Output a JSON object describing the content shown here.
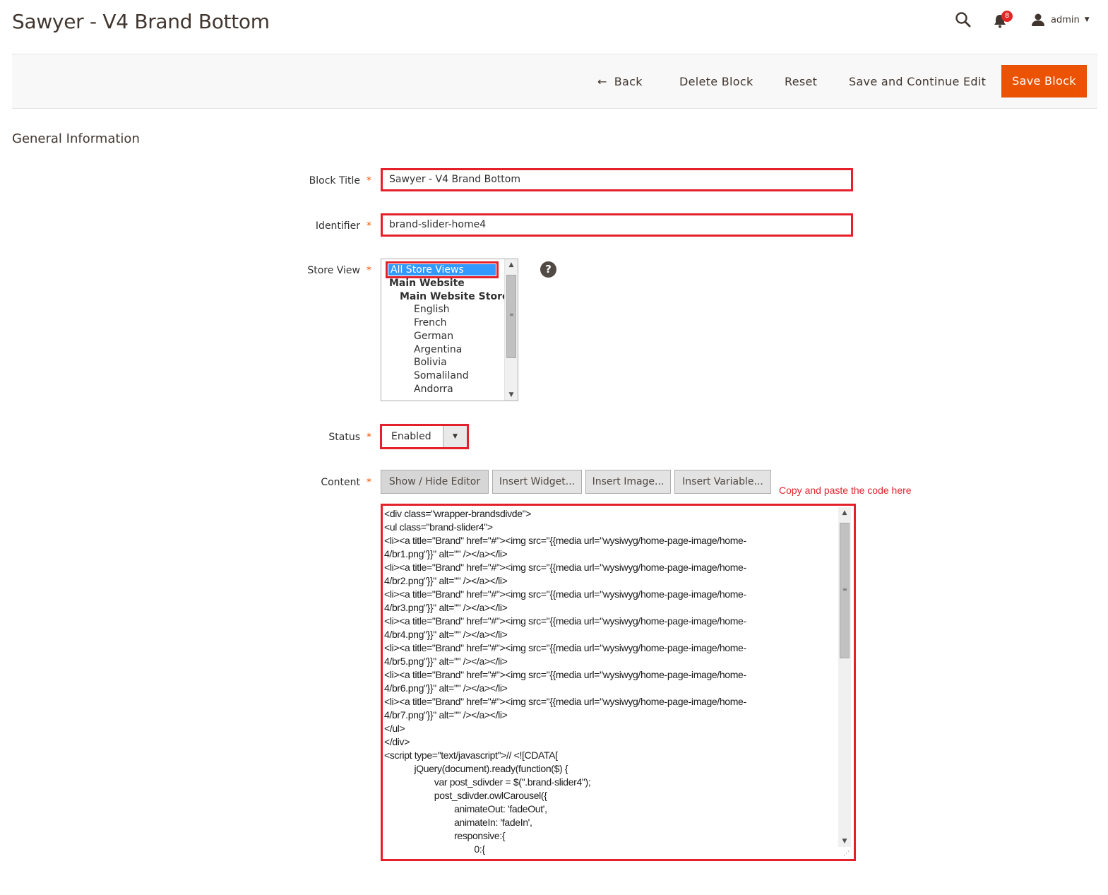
{
  "header": {
    "title": "Sawyer - V4 Brand Bottom",
    "notification_count": "8",
    "user_name": "admin"
  },
  "actions": {
    "back_label": "Back",
    "delete_label": "Delete Block",
    "reset_label": "Reset",
    "save_continue_label": "Save and Continue Edit",
    "save_label": "Save Block"
  },
  "section": {
    "title": "General Information"
  },
  "form": {
    "block_title": {
      "label": "Block Title",
      "value": "Sawyer - V4 Brand Bottom"
    },
    "identifier": {
      "label": "Identifier",
      "value": "brand-slider-home4"
    },
    "store_view": {
      "label": "Store View",
      "selected": "All Store Views",
      "options": [
        {
          "text": "Main Website",
          "level": 0,
          "bold": true
        },
        {
          "text": "Main Website Store",
          "level": 1,
          "bold": true
        },
        {
          "text": "English",
          "level": 2,
          "bold": false
        },
        {
          "text": "French",
          "level": 2,
          "bold": false
        },
        {
          "text": "German",
          "level": 2,
          "bold": false
        },
        {
          "text": "Argentina",
          "level": 2,
          "bold": false
        },
        {
          "text": "Bolivia",
          "level": 2,
          "bold": false
        },
        {
          "text": "Somaliland",
          "level": 2,
          "bold": false
        },
        {
          "text": "Andorra",
          "level": 2,
          "bold": false
        }
      ]
    },
    "status": {
      "label": "Status",
      "value": "Enabled"
    },
    "content": {
      "label": "Content",
      "buttons": [
        "Show / Hide Editor",
        "Insert Widget...",
        "Insert Image...",
        "Insert Variable..."
      ],
      "annotation": "Copy and paste the code here",
      "code": "<div class=\"wrapper-brandsdivde\">\n<ul class=\"brand-slider4\">\n<li><a title=\"Brand\" href=\"#\"><img src=\"{{media url=\"wysiwyg/home-page-image/home-\n4/br1.png\"}}\" alt=\"\" /></a></li>\n<li><a title=\"Brand\" href=\"#\"><img src=\"{{media url=\"wysiwyg/home-page-image/home-\n4/br2.png\"}}\" alt=\"\" /></a></li>\n<li><a title=\"Brand\" href=\"#\"><img src=\"{{media url=\"wysiwyg/home-page-image/home-\n4/br3.png\"}}\" alt=\"\" /></a></li>\n<li><a title=\"Brand\" href=\"#\"><img src=\"{{media url=\"wysiwyg/home-page-image/home-\n4/br4.png\"}}\" alt=\"\" /></a></li>\n<li><a title=\"Brand\" href=\"#\"><img src=\"{{media url=\"wysiwyg/home-page-image/home-\n4/br5.png\"}}\" alt=\"\" /></a></li>\n<li><a title=\"Brand\" href=\"#\"><img src=\"{{media url=\"wysiwyg/home-page-image/home-\n4/br6.png\"}}\" alt=\"\" /></a></li>\n<li><a title=\"Brand\" href=\"#\"><img src=\"{{media url=\"wysiwyg/home-page-image/home-\n4/br7.png\"}}\" alt=\"\" /></a></li>\n</ul>\n</div>\n<script type=\"text/javascript\">// <![CDATA[\n            jQuery(document).ready(function($) {\n                    var post_sdivder = $(\".brand-slider4\");\n                    post_sdivder.owlCarousel({\n                            animateOut: 'fadeOut',\n                            animateIn: 'fadeIn',\n                            responsive:{\n                                    0:{"
    }
  }
}
